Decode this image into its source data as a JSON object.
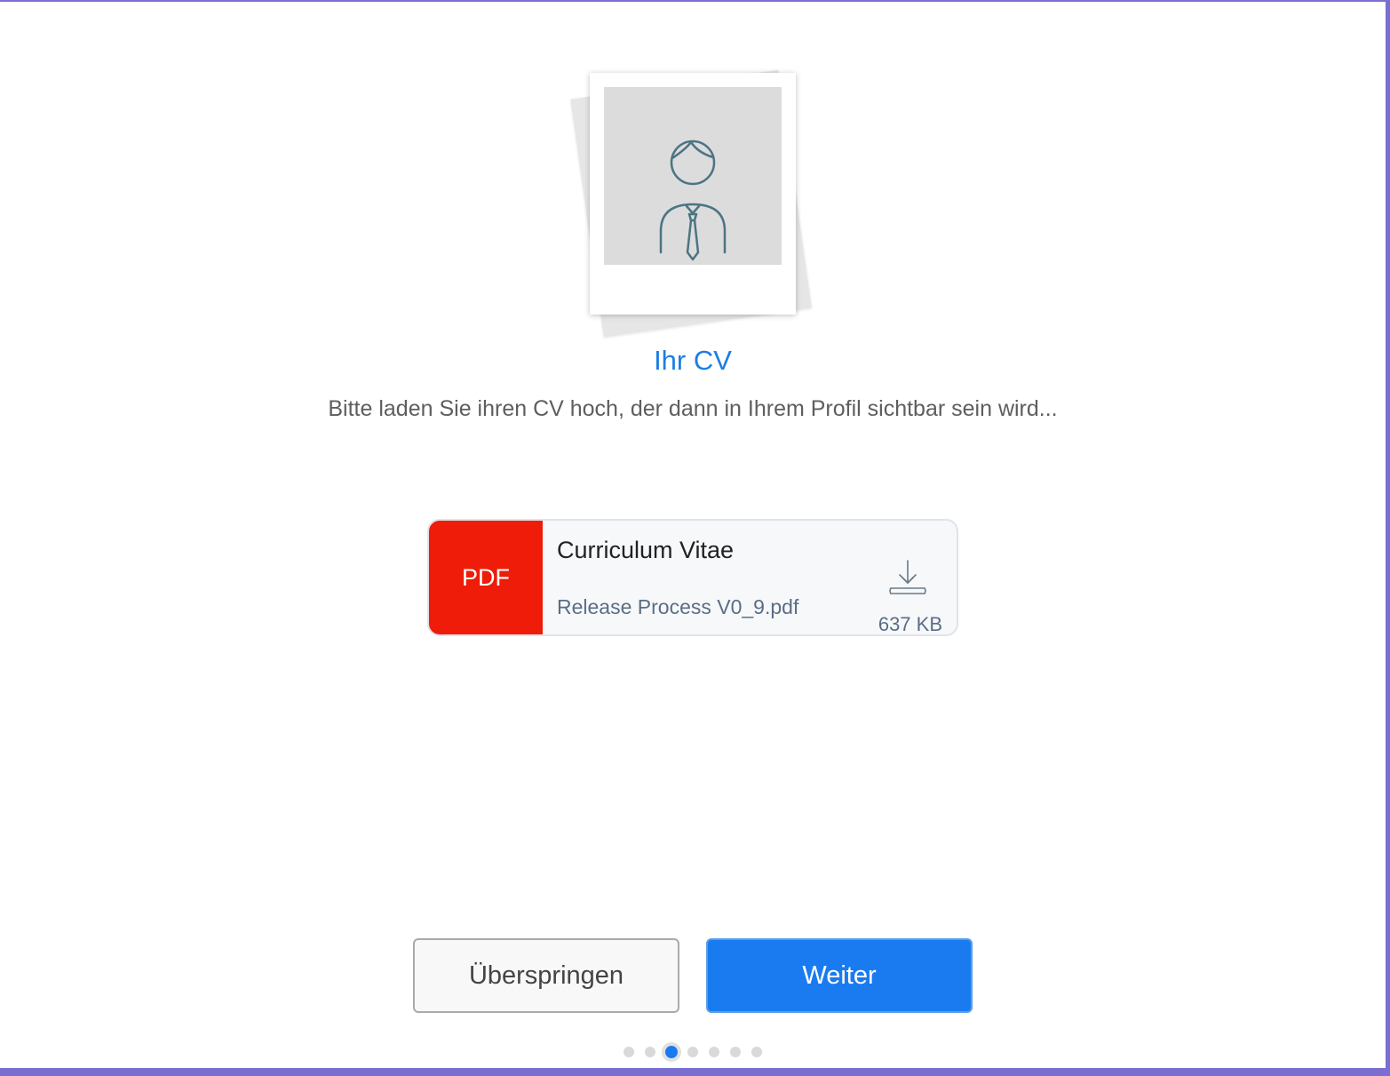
{
  "onboarding": {
    "title": "Ihr CV",
    "subtitle": "Bitte laden Sie ihren CV hoch, der dann in Ihrem Profil sichtbar sein wird..."
  },
  "illustration": {
    "icon": "person-with-tie-icon",
    "photo_color": "#dcdcdc",
    "line_color": "#4b7484"
  },
  "file": {
    "type_label": "PDF",
    "type_color": "#ee1c08",
    "title": "Curriculum Vitae",
    "filename": "Release Process V0_9.pdf",
    "size": "637 KB",
    "action_icon": "download-icon"
  },
  "buttons": {
    "skip_label": "Überspringen",
    "next_label": "Weiter",
    "accent_color": "#1a7bf0"
  },
  "pagination": {
    "total": 7,
    "current": 3
  }
}
